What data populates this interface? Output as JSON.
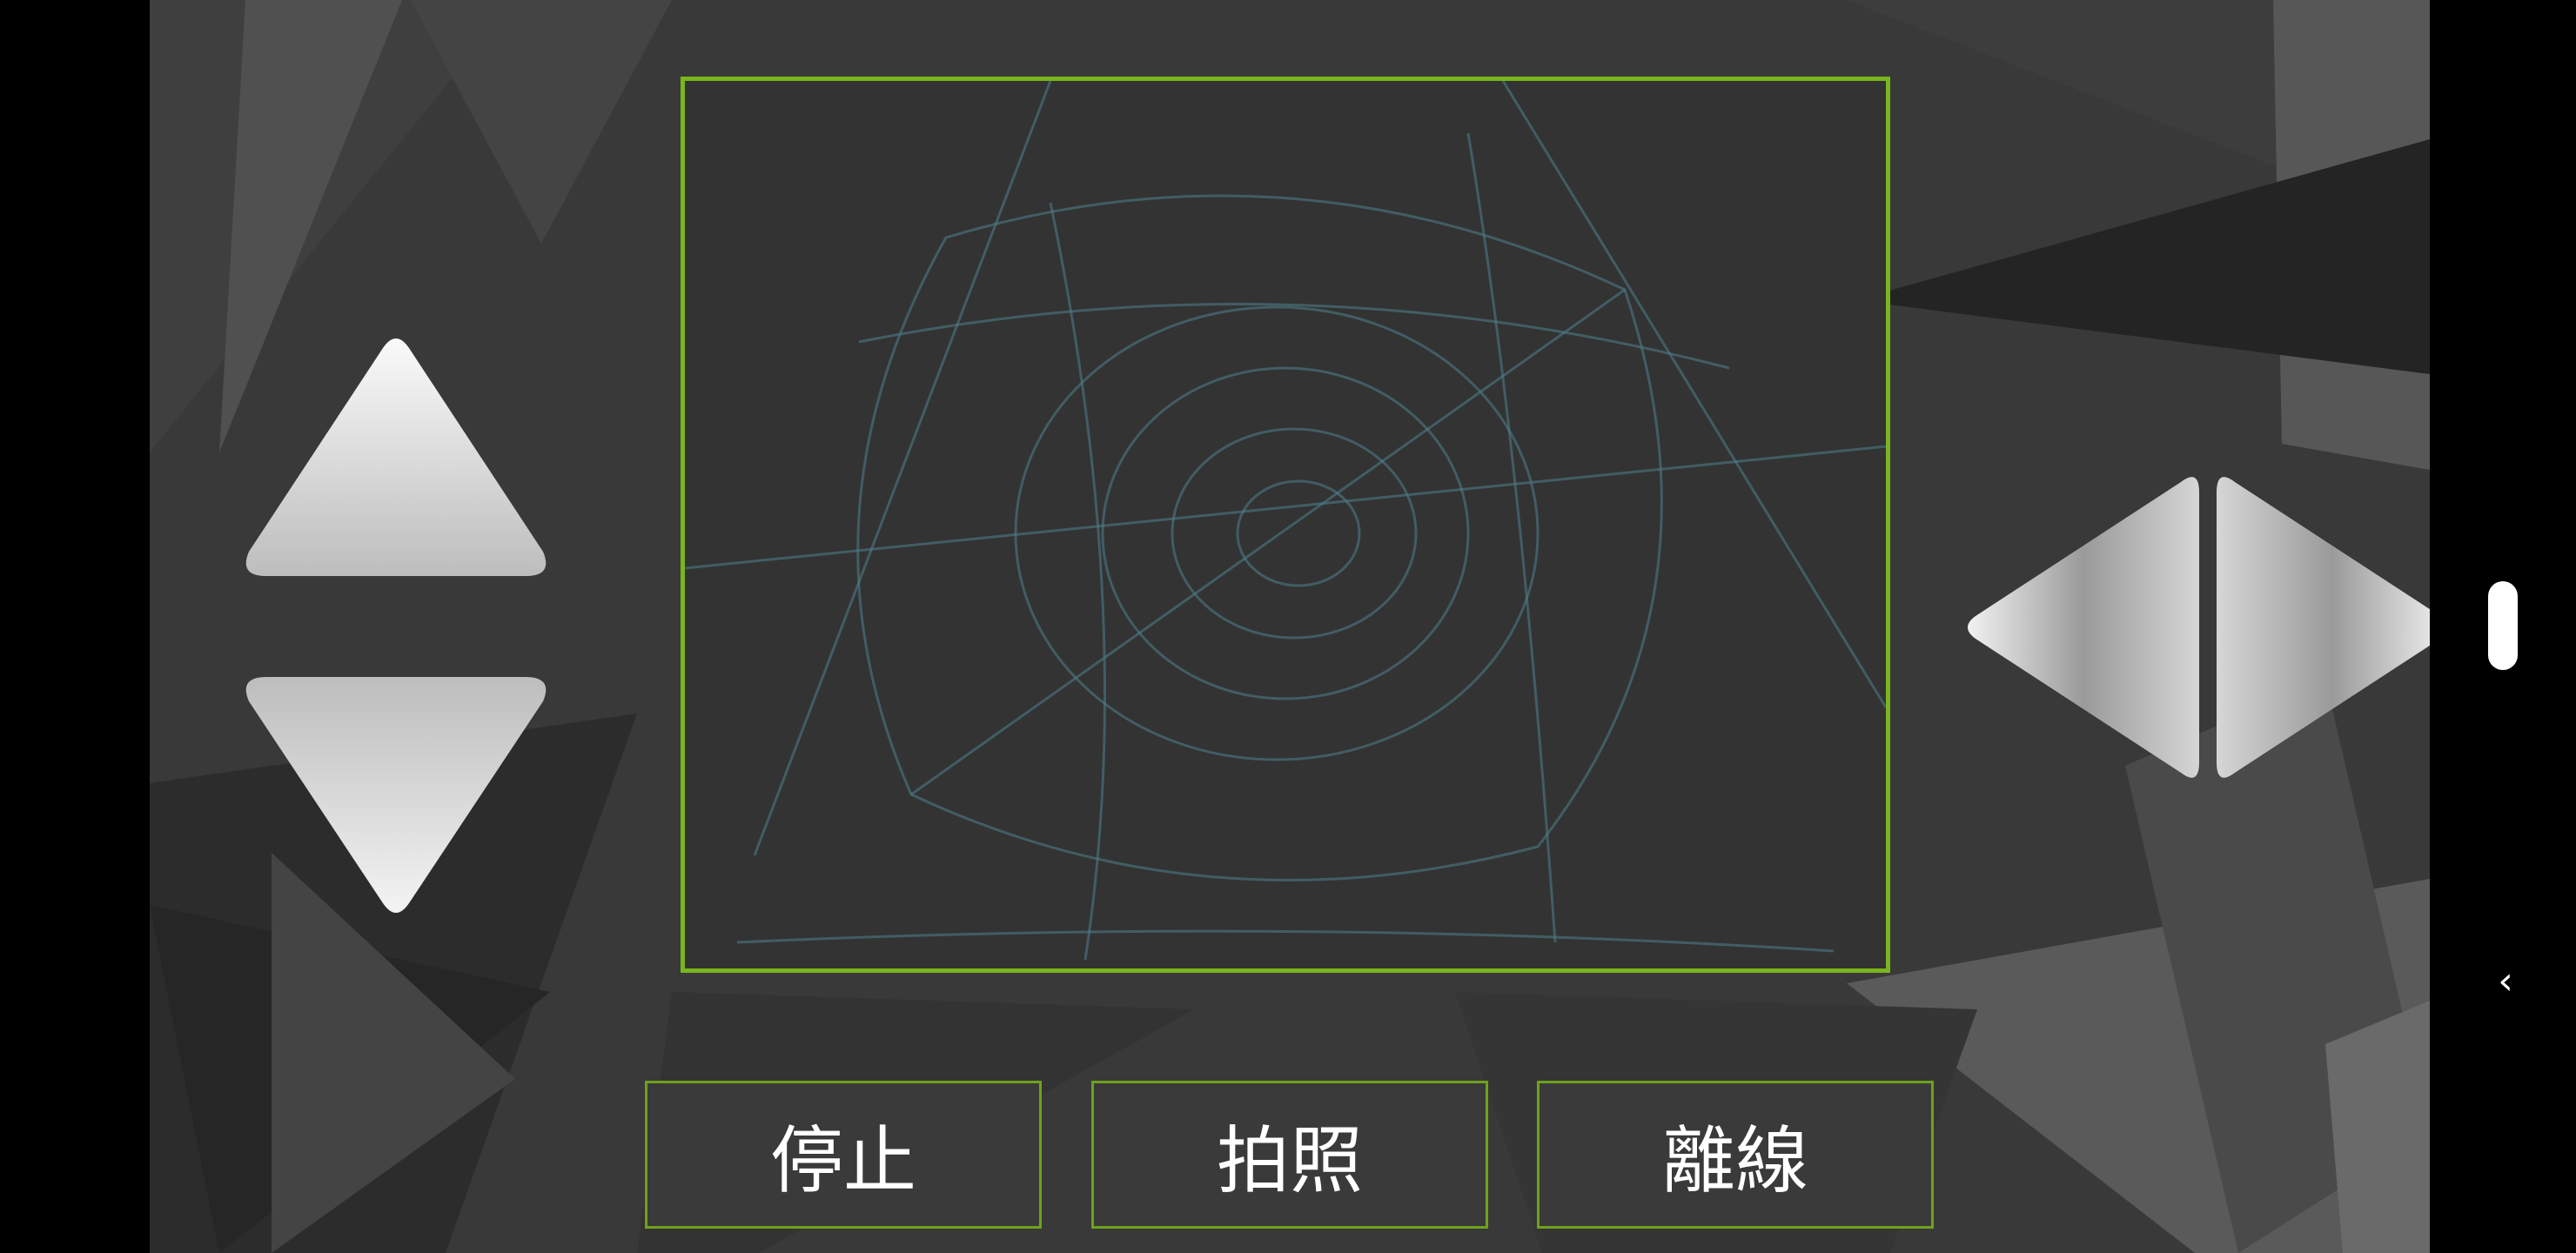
{
  "colors": {
    "accent": "#7ab51d",
    "background": "#393939",
    "smoke": "#4f7f8d"
  },
  "controls": {
    "up_icon": "triangle-up",
    "down_icon": "triangle-down",
    "left_icon": "triangle-left",
    "right_icon": "triangle-right"
  },
  "buttons": {
    "stop": "停止",
    "photo": "拍照",
    "disconnect": "離線"
  },
  "system_nav": {
    "handle_icon": "nav-handle",
    "back_icon": "chevron-left-icon",
    "back_glyph": "‹"
  }
}
